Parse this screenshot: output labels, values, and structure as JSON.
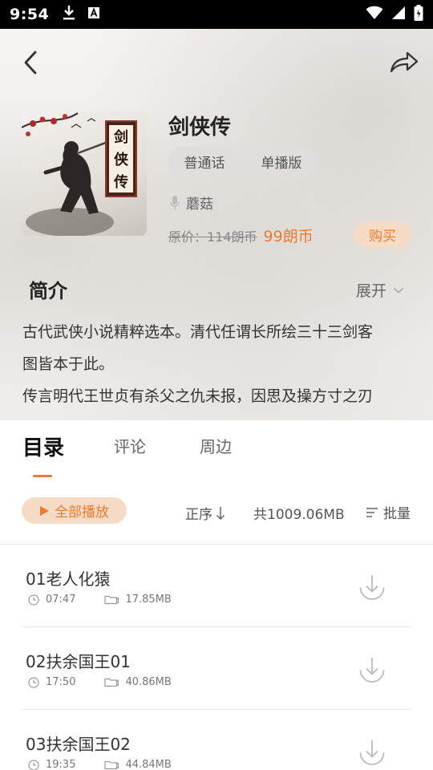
{
  "status_bar": {
    "time": "9:54",
    "icons": [
      "download-icon",
      "a-icon",
      "wifi-icon",
      "signal-icon",
      "battery-icon"
    ]
  },
  "header": {
    "back_icon": "chevron-left-icon",
    "share_icon": "share-icon"
  },
  "book": {
    "cover_seal_chars": [
      "剑",
      "侠",
      "传"
    ],
    "title": "剑侠传",
    "tags": [
      "普通话",
      "单播版"
    ],
    "narrator": "蘑菇",
    "original_price": "原价：114朗币",
    "price": "99朗币",
    "buy_label": "购买"
  },
  "intro": {
    "title": "简介",
    "expand_label": "展开",
    "lines": [
      "古代武侠小说精粹选本。清代任谓长所绘三十三剑客",
      "图皆本于此。",
      "传言明代王世贞有杀父之仇未报，因思及操方寸之刃"
    ]
  },
  "tabs": [
    {
      "label": "目录",
      "active": true
    },
    {
      "label": "评论",
      "active": false
    },
    {
      "label": "周边",
      "active": false
    }
  ],
  "toolbar": {
    "play_all_label": "全部播放",
    "sort_label": "正序",
    "total_size": "共1009.06MB",
    "batch_label": "批量"
  },
  "episodes": [
    {
      "title": "01老人化猿",
      "duration": "07:47",
      "size": "17.85MB"
    },
    {
      "title": "02扶余国王01",
      "duration": "17:50",
      "size": "40.86MB"
    },
    {
      "title": "03扶余国王02",
      "duration": "19:35",
      "size": "44.84MB"
    }
  ],
  "colors": {
    "accent": "#f07a2e",
    "accent_bg": "#f6dcc6",
    "tag_bg": "#e0dedb"
  }
}
